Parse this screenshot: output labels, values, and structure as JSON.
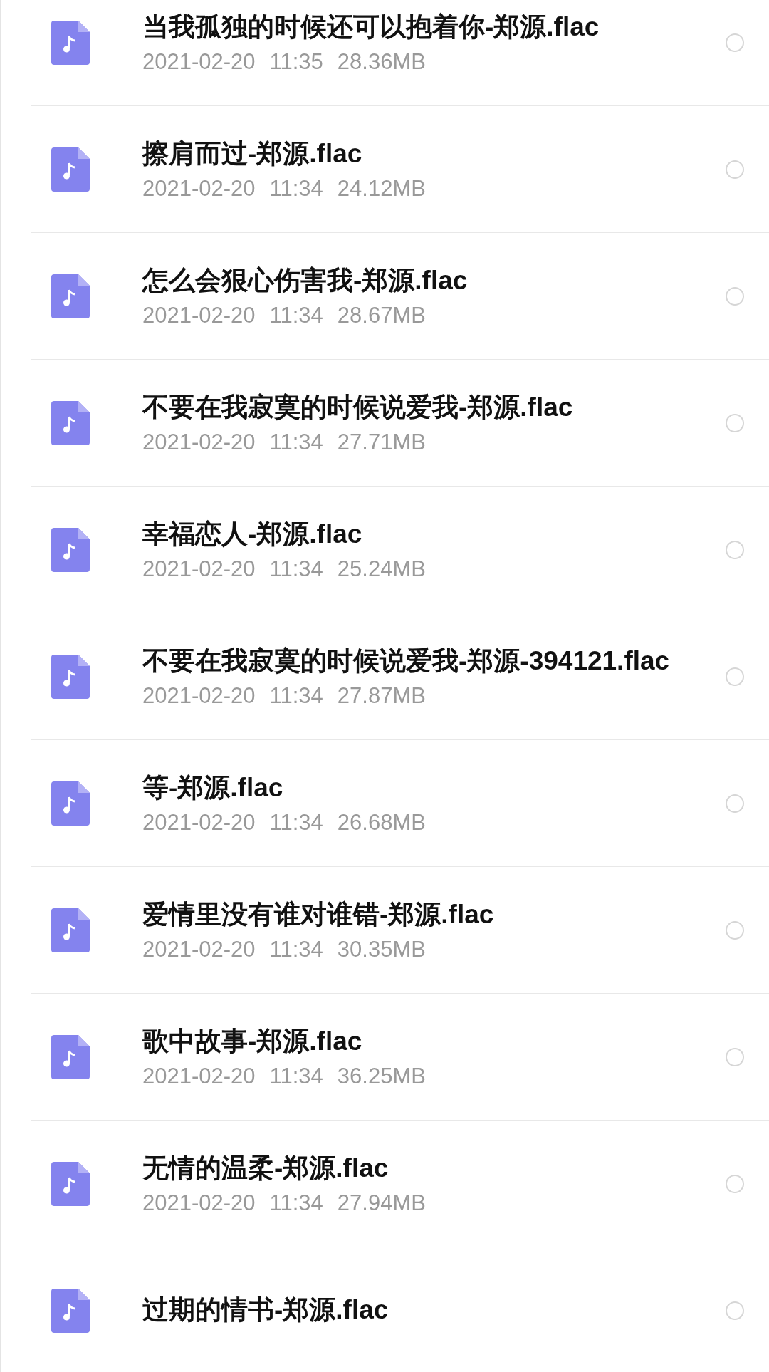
{
  "files": [
    {
      "name": "当我孤独的时候还可以抱着你-郑源.flac",
      "date": "2021-02-20",
      "time": "11:35",
      "size": "28.36MB",
      "selected": false
    },
    {
      "name": "擦肩而过-郑源.flac",
      "date": "2021-02-20",
      "time": "11:34",
      "size": "24.12MB",
      "selected": false
    },
    {
      "name": "怎么会狠心伤害我-郑源.flac",
      "date": "2021-02-20",
      "time": "11:34",
      "size": "28.67MB",
      "selected": false
    },
    {
      "name": "不要在我寂寞的时候说爱我-郑源.flac",
      "date": "2021-02-20",
      "time": "11:34",
      "size": "27.71MB",
      "selected": false
    },
    {
      "name": "幸福恋人-郑源.flac",
      "date": "2021-02-20",
      "time": "11:34",
      "size": "25.24MB",
      "selected": false
    },
    {
      "name": "不要在我寂寞的时候说爱我-郑源-394121.flac",
      "date": "2021-02-20",
      "time": "11:34",
      "size": "27.87MB",
      "selected": false
    },
    {
      "name": "等-郑源.flac",
      "date": "2021-02-20",
      "time": "11:34",
      "size": "26.68MB",
      "selected": false
    },
    {
      "name": "爱情里没有谁对谁错-郑源.flac",
      "date": "2021-02-20",
      "time": "11:34",
      "size": "30.35MB",
      "selected": false
    },
    {
      "name": "歌中故事-郑源.flac",
      "date": "2021-02-20",
      "time": "11:34",
      "size": "36.25MB",
      "selected": false
    },
    {
      "name": "无情的温柔-郑源.flac",
      "date": "2021-02-20",
      "time": "11:34",
      "size": "27.94MB",
      "selected": false
    },
    {
      "name": "过期的情书-郑源.flac",
      "selected": false
    }
  ]
}
